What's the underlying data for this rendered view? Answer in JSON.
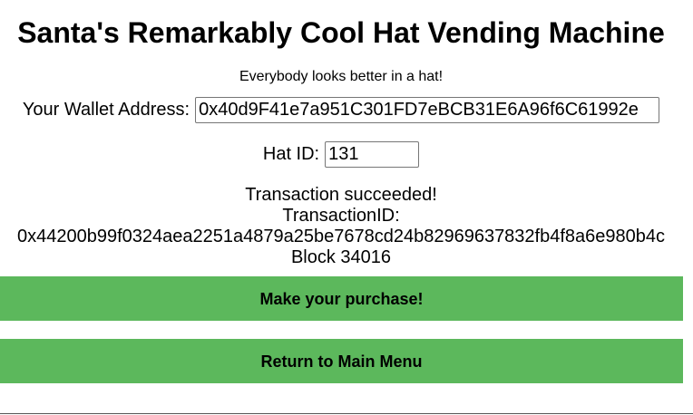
{
  "header": {
    "title": "Santa's Remarkably Cool Hat Vending Machine",
    "subtitle": "Everybody looks better in a hat!"
  },
  "form": {
    "wallet_label": "Your Wallet Address:",
    "wallet_value": "0x40d9F41e7a951C301FD7eBCB31E6A96f6C61992e",
    "hat_label": "Hat ID:",
    "hat_value": "131"
  },
  "result": {
    "status": "Transaction succeeded!",
    "txid_label": "TransactionID:",
    "txid": "0x44200b99f0324aea2251a4879a25be7678cd24b82969637832fb4f8a6e980b4c",
    "block": "Block 34016"
  },
  "buttons": {
    "purchase": "Make your purchase!",
    "menu": "Return to Main Menu"
  },
  "colors": {
    "button_green": "#5cb85c"
  }
}
